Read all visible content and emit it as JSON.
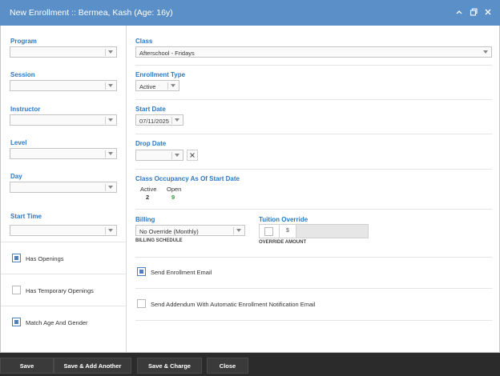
{
  "window": {
    "title": "New Enrollment :: Bermea, Kash (Age: 16y)",
    "controls": [
      "chevron-up-icon",
      "restore-icon",
      "close-icon"
    ]
  },
  "left": {
    "program_label": "Program",
    "session_label": "Session",
    "instructor_label": "Instructor",
    "level_label": "Level",
    "day_label": "Day",
    "start_time_label": "Start Time",
    "has_openings": "Has Openings",
    "has_temporary_openings": "Has Temporary Openings",
    "match_age_gender": "Match Age And Gender"
  },
  "right": {
    "class_label": "Class",
    "class_value": "Afterschool - Fridays",
    "enrollment_type_label": "Enrollment Type",
    "enrollment_type_value": "Active",
    "start_date_label": "Start Date",
    "start_date_value": "07/11/2025",
    "drop_date_label": "Drop Date",
    "occupancy_label": "Class Occupancy As Of Start Date",
    "occupancy_active_label": "Active",
    "occupancy_active_value": "2",
    "occupancy_open_label": "Open",
    "occupancy_open_value": "9",
    "billing_label": "Billing",
    "billing_value": "No Override (Monthly)",
    "billing_schedule_label": "BILLING SCHEDULE",
    "tuition_override_label": "Tuition Override",
    "tuition_currency": "$",
    "override_amount_label": "OVERRIDE AMOUNT",
    "send_email": "Send Enrollment Email",
    "send_addendum": "Send Addendum With Automatic Enrollment Notification Email"
  },
  "footer": {
    "save": "Save",
    "save_add": "Save & Add Another",
    "save_charge": "Save & Charge",
    "close": "Close"
  },
  "colors": {
    "titlebar": "#5b8fc7",
    "label_blue": "#2d78c4",
    "open_green": "#2e9a3e",
    "footer": "#2b2b2b",
    "checkbox_fill": "#4f7fbf"
  }
}
